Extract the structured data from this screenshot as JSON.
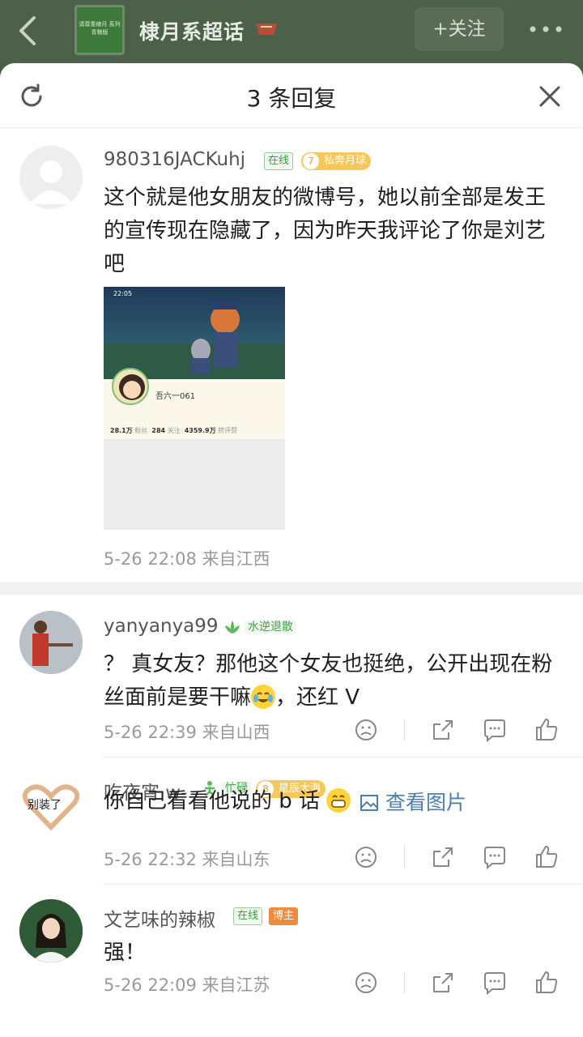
{
  "header": {
    "group_avatar_text": "请尊重棣月 系列青粮版",
    "group_name": "棣月系超话",
    "follow_label": "+关注"
  },
  "sheet": {
    "title": "3 条回复"
  },
  "main_comment": {
    "username": "980316JACKuhj",
    "online_label": "在线",
    "fan_level": "7",
    "fan_label": "私奔月球",
    "text": "这个就是他女朋友的微博号，她以前全部是发王的宣传现在隐藏了，因为昨天我评论了你是刘艺吧",
    "meta": "5-26 22:08  来自江西",
    "image": {
      "time": "22:05",
      "profile_name": "吾六一061",
      "stat1": "28.1万",
      "stat1_label": "粉丝",
      "stat2": "284",
      "stat2_label": "关注",
      "stat3": "4359.9万",
      "stat3_label": "转评赞"
    }
  },
  "replies": [
    {
      "username": "yanyanya99",
      "badge": "水逆退散",
      "text_before": "？ 真女友？那他这个女友也挺绝，公开出现在粉丝面前是要干嘛",
      "text_after": "，还红 V",
      "meta": "5-26 22:39  来自山西"
    },
    {
      "username": "吃夜宵 w-",
      "avatar_text": "别装了",
      "badge": "忙碌",
      "fan_level": "8",
      "fan_label": "星辰大海",
      "text": "你自己看看他说的 b 话",
      "link": "查看图片",
      "meta": "5-26 22:32  来自山东"
    },
    {
      "username": "文艺味的辣椒",
      "online_label": "在线",
      "host_label": "博主",
      "text": "强！",
      "meta": "5-26 22:09  来自江苏"
    }
  ],
  "colors": {
    "header_bg": "#4d6049",
    "online_green": "#3d9a3a",
    "fan_badge": "#f7c75a",
    "host_badge": "#f08a3c",
    "link_blue": "#4a7fb5"
  }
}
